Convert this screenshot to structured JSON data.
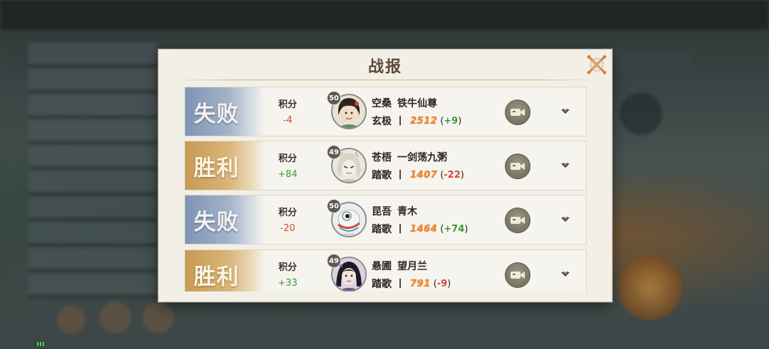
{
  "dialog": {
    "title": "战报",
    "close_icon": "close-x-icon"
  },
  "records": [
    {
      "result": "失败",
      "result_type": "lose",
      "score_label": "积分",
      "score_change": "-4",
      "score_sign": "neg",
      "level": "50",
      "server": "空桑",
      "player": "铁牛仙尊",
      "sect": "玄极",
      "separator": "丨",
      "rating": "2512",
      "delta_open": "(",
      "delta": "+9",
      "delta_close": ")",
      "delta_sign": "pos"
    },
    {
      "result": "胜利",
      "result_type": "win",
      "score_label": "积分",
      "score_change": "+84",
      "score_sign": "pos",
      "level": "49",
      "server": "苍梧",
      "player": "一剑荡九粥",
      "sect": "踏歌",
      "separator": "丨",
      "rating": "1407",
      "delta_open": "(",
      "delta": "-22",
      "delta_close": ")",
      "delta_sign": "neg"
    },
    {
      "result": "失败",
      "result_type": "lose",
      "score_label": "积分",
      "score_change": "-20",
      "score_sign": "neg",
      "level": "50",
      "server": "昆吾",
      "player": "青木",
      "sect": "踏歌",
      "separator": "丨",
      "rating": "1464",
      "delta_open": "(",
      "delta": "+74",
      "delta_close": ")",
      "delta_sign": "pos"
    },
    {
      "result": "胜利",
      "result_type": "win",
      "score_label": "积分",
      "score_change": "+33",
      "score_sign": "pos",
      "level": "49",
      "server": "悬圃",
      "player": "望月兰",
      "sect": "踏歌",
      "separator": "丨",
      "rating": "791",
      "delta_open": "(",
      "delta": "-9",
      "delta_close": ")",
      "delta_sign": "neg"
    }
  ],
  "icons": {
    "replay": "video-camera-icon",
    "expand": "chevron-down-icon",
    "avatar": "player-avatar"
  },
  "colors": {
    "lose_banner": "#8fa3bf",
    "win_banner": "#d1a763",
    "negative": "#d2483a",
    "positive": "#3f9a3c",
    "rating": "#f08a2a",
    "close_accent": "#e07a3a"
  }
}
